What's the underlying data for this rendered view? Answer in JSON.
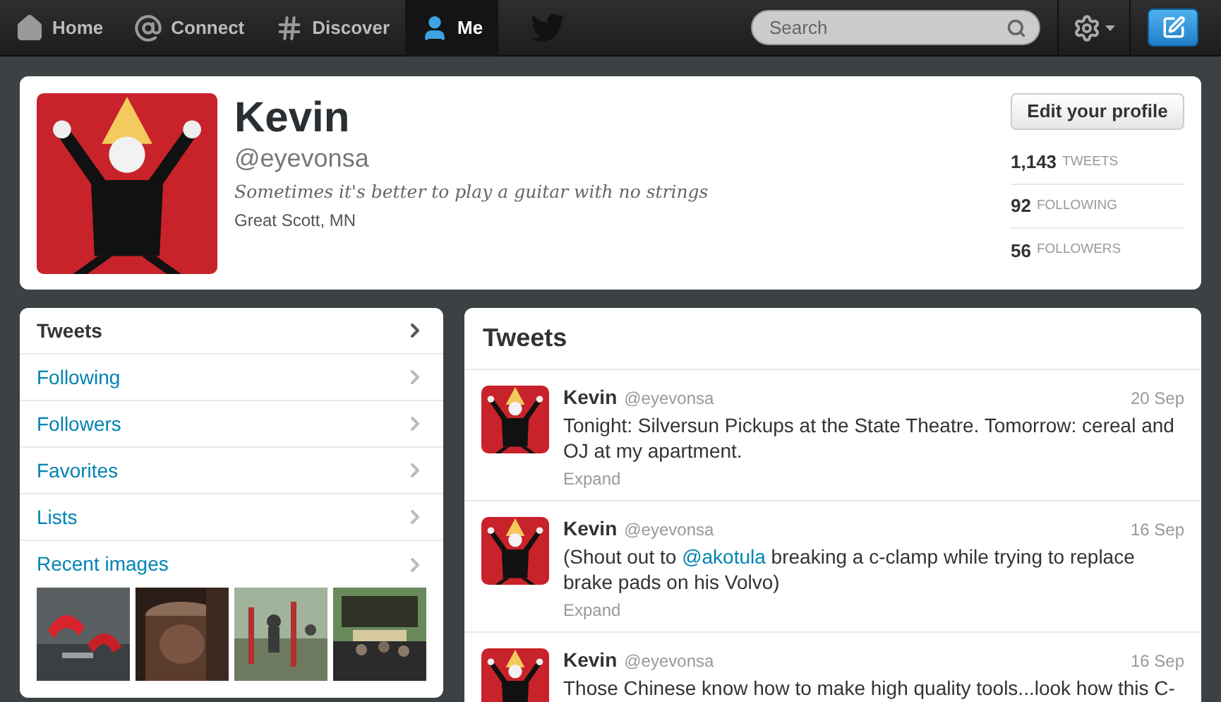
{
  "nav": {
    "items": [
      {
        "label": "Home",
        "kind": "home",
        "selected": false
      },
      {
        "label": "Connect",
        "kind": "at",
        "selected": false
      },
      {
        "label": "Discover",
        "kind": "hash",
        "selected": false
      },
      {
        "label": "Me",
        "kind": "user",
        "selected": true
      }
    ],
    "search": {
      "placeholder": "Search"
    }
  },
  "profile": {
    "name": "Kevin",
    "handle": "@eyevonsa",
    "bio": "Sometimes it's better to play a guitar with no strings",
    "location": "Great Scott, MN",
    "edit_button": "Edit your profile",
    "stats": [
      {
        "count": "1,143",
        "label": "TWEETS"
      },
      {
        "count": "92",
        "label": "FOLLOWING"
      },
      {
        "count": "56",
        "label": "FOLLOWERS"
      }
    ]
  },
  "sidebar": {
    "items": [
      {
        "label": "Tweets",
        "selected": true
      },
      {
        "label": "Following",
        "selected": false
      },
      {
        "label": "Followers",
        "selected": false
      },
      {
        "label": "Favorites",
        "selected": false
      },
      {
        "label": "Lists",
        "selected": false
      },
      {
        "label": "Recent images",
        "selected": false
      }
    ]
  },
  "timeline": {
    "title": "Tweets",
    "tweets": [
      {
        "name": "Kevin",
        "handle": "@eyevonsa",
        "date": "20 Sep",
        "segments": [
          {
            "kind": "plain",
            "text": "Tonight: Silversun Pickups at the State Theatre. Tomorrow: cereal and OJ at my apartment."
          }
        ],
        "expand": "Expand"
      },
      {
        "name": "Kevin",
        "handle": "@eyevonsa",
        "date": "16 Sep",
        "segments": [
          {
            "kind": "plain",
            "text": "(Shout out to "
          },
          {
            "kind": "mention",
            "text": "@akotula"
          },
          {
            "kind": "plain",
            "text": " breaking a c-clamp while trying to replace brake pads on his Volvo)"
          }
        ],
        "expand": "Expand"
      },
      {
        "name": "Kevin",
        "handle": "@eyevonsa",
        "date": "16 Sep",
        "segments": [
          {
            "kind": "plain",
            "text": "Those Chinese know how to make high quality tools...look how this C-"
          }
        ]
      }
    ]
  }
}
